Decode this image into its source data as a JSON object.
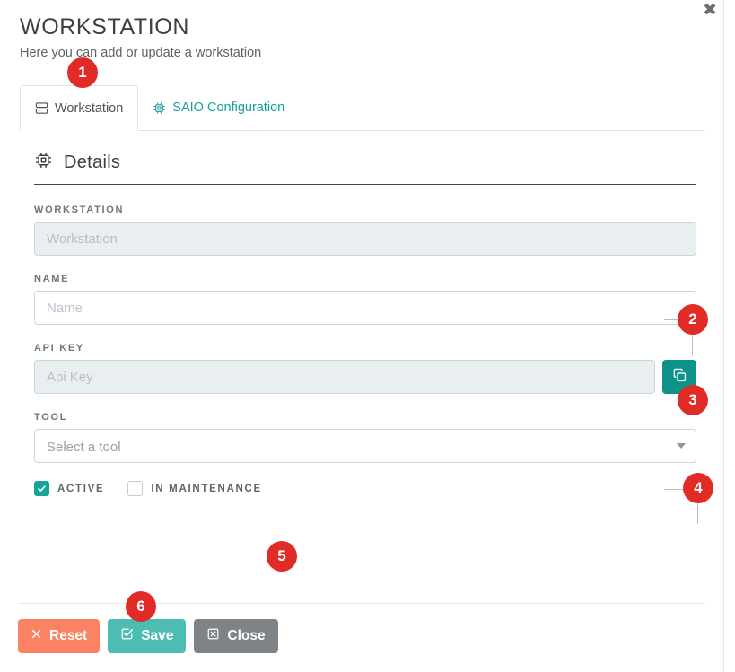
{
  "modal": {
    "close_icon": "close-x-icon",
    "title": "WORKSTATION",
    "subtitle": "Here you can add or update a workstation"
  },
  "tabs": [
    {
      "label": "Workstation",
      "icon": "server-icon",
      "active": true
    },
    {
      "label": "SAIO Configuration",
      "icon": "cpu-chip-icon",
      "active": false
    }
  ],
  "section": {
    "icon": "cpu-chip-icon",
    "title": "Details"
  },
  "fields": {
    "workstation": {
      "label": "WORKSTATION",
      "placeholder": "Workstation",
      "value": "",
      "disabled": true
    },
    "name": {
      "label": "NAME",
      "placeholder": "Name",
      "value": "",
      "disabled": false
    },
    "api_key": {
      "label": "API KEY",
      "placeholder": "Api Key",
      "value": "",
      "disabled": true,
      "copy_icon": "copy-icon"
    },
    "tool": {
      "label": "TOOL",
      "placeholder": "Select a tool",
      "value": "",
      "caret_icon": "chevron-down-icon"
    }
  },
  "checkboxes": [
    {
      "label": "ACTIVE",
      "checked": true
    },
    {
      "label": "IN MAINTENANCE",
      "checked": false
    }
  ],
  "footer_buttons": [
    {
      "label": "Reset",
      "icon": "x-icon",
      "color": "#fb8262"
    },
    {
      "label": "Save",
      "icon": "check-square-icon",
      "color": "#4dbdb4"
    },
    {
      "label": "Close",
      "icon": "x-square-icon",
      "color": "#7e8387"
    }
  ],
  "annotations": [
    {
      "number": "1"
    },
    {
      "number": "2"
    },
    {
      "number": "3"
    },
    {
      "number": "4"
    },
    {
      "number": "5"
    },
    {
      "number": "6"
    }
  ],
  "colors": {
    "teal": "#17a398",
    "badge_red": "#e02b27",
    "reset_orange": "#fb8262",
    "save_teal": "#4dbdb4",
    "close_grey": "#7e8387"
  }
}
